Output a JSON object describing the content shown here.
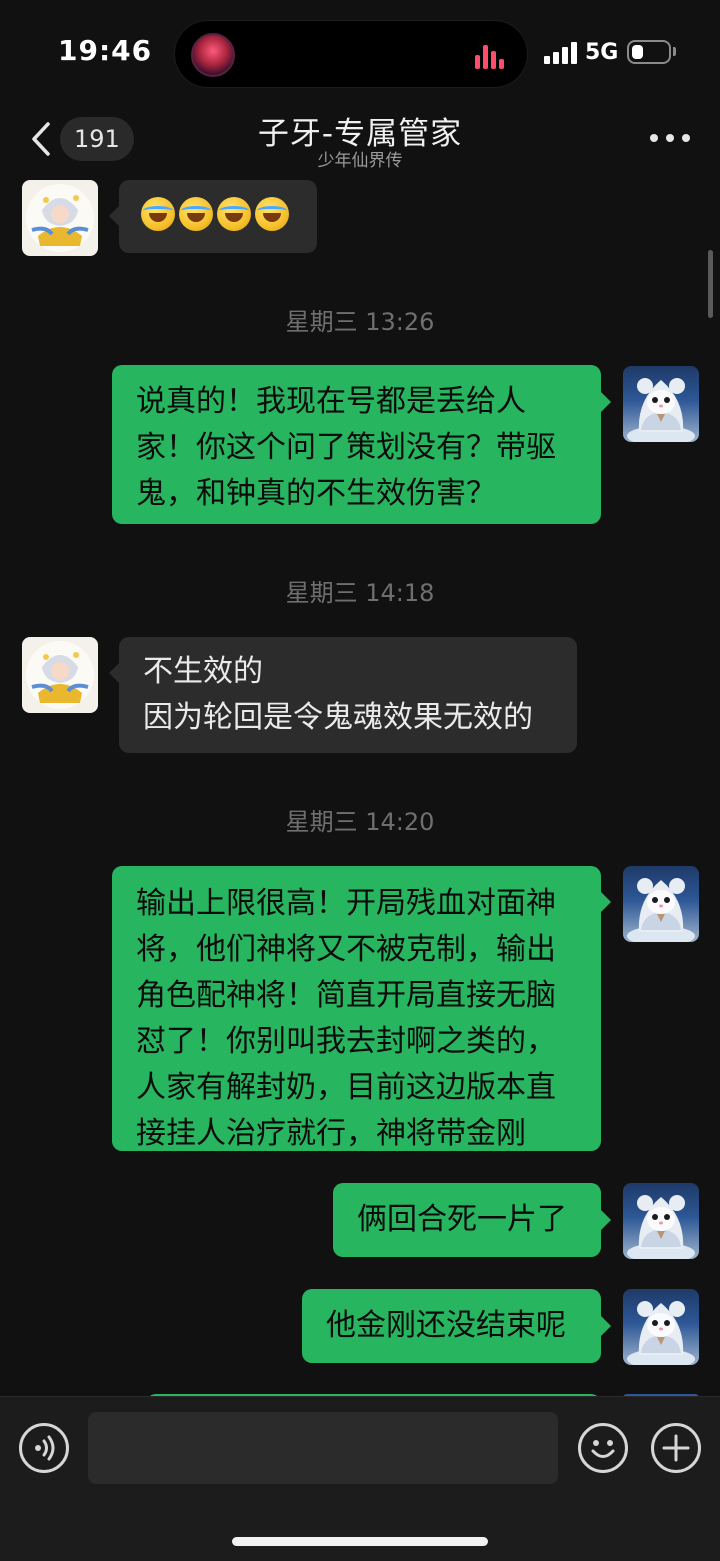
{
  "status_bar": {
    "time": "19:46",
    "network": "5G"
  },
  "header": {
    "back_count": "191",
    "title": "子牙-专属管家",
    "subtitle": "少年仙界传"
  },
  "messages": [
    {
      "type": "in",
      "content": "emoji",
      "emoji": [
        "laughing-with-tears",
        "laughing-with-tears",
        "laughing-with-tears",
        "laughing-with-tears"
      ]
    },
    {
      "type": "time",
      "text": "星期三 13:26"
    },
    {
      "type": "out",
      "text": "说真的！我现在号都是丢给人家！你这个问了策划没有？带驱鬼，和钟真的不生效伤害？"
    },
    {
      "type": "time",
      "text": "星期三 14:18"
    },
    {
      "type": "in",
      "lines": [
        "不生效的",
        "因为轮回是令鬼魂效果无效的"
      ]
    },
    {
      "type": "time",
      "text": "星期三 14:20"
    },
    {
      "type": "out",
      "text": "输出上限很高！开局残血对面神将，他们神将又不被克制，输出角色配神将！简直开局直接无脑怼了！你别叫我去封啊之类的，人家有解封奶，目前这边版本直接挂人治疗就行，神将带金刚"
    },
    {
      "type": "out",
      "text": "俩回合死一片了"
    },
    {
      "type": "out",
      "text": "他金刚还没结束呢"
    }
  ],
  "input": {
    "placeholder": ""
  },
  "colors": {
    "background": "#111111",
    "bubble_self": "#27b55f",
    "bubble_other": "#2c2c2c",
    "timestamp": "#6f6f6f"
  }
}
